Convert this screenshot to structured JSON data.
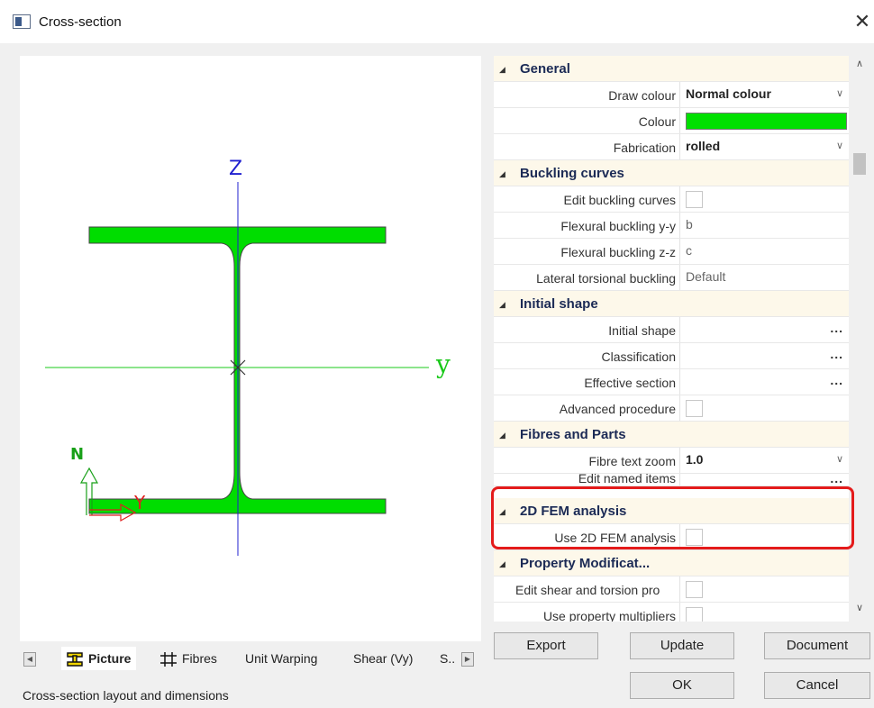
{
  "window": {
    "title": "Cross-section",
    "close_glyph": "✕"
  },
  "preview": {
    "axis_z": "Z",
    "axis_y": "y",
    "local_n": "N",
    "local_y": "Y",
    "profile_color": "#00dd00",
    "z_axis_color": "#1f1fcf",
    "y_axis_color": "#19c819",
    "local_n_color": "#18a018",
    "local_y_color": "#e02020"
  },
  "tabs": [
    {
      "label": "Picture",
      "icon": "i-beam-icon"
    },
    {
      "label": "Fibres",
      "icon": "grid-hash-icon"
    },
    {
      "label": "Unit Warping"
    },
    {
      "label": "Shear (Vy)"
    },
    {
      "label": "S.."
    }
  ],
  "status": {
    "text": "Cross-section layout and dimensions"
  },
  "properties": {
    "general": {
      "label": "General",
      "draw_colour_label": "Draw colour",
      "draw_colour_value": "Normal colour",
      "colour_label": "Colour",
      "colour_value": "#00e000",
      "fabrication_label": "Fabrication",
      "fabrication_value": "rolled"
    },
    "buckling": {
      "label": "Buckling curves",
      "edit_label": "Edit buckling curves",
      "yy_label": "Flexural buckling y-y",
      "yy_value": "b",
      "zz_label": "Flexural buckling z-z",
      "zz_value": "c",
      "ltb_label": "Lateral torsional buckling",
      "ltb_value": "Default"
    },
    "initial_shape": {
      "label": "Initial shape",
      "initial_shape_label": "Initial shape",
      "classification_label": "Classification",
      "effective_label": "Effective section",
      "advanced_label": "Advanced procedure",
      "ellipsis": "..."
    },
    "fibres": {
      "label": "Fibres and Parts",
      "zoom_label": "Fibre text zoom",
      "zoom_value": "1.0",
      "named_label": "Edit named items"
    },
    "fem": {
      "label": "2D FEM analysis",
      "use_label": "Use 2D FEM analysis"
    },
    "property_mod": {
      "label": "Property Modificat...",
      "shear_label": "Edit shear and torsion pro",
      "multipliers_label": "Use property multipliers"
    }
  },
  "buttons": {
    "export": "Export",
    "update": "Update",
    "document": "Document",
    "ok": "OK",
    "cancel": "Cancel"
  }
}
